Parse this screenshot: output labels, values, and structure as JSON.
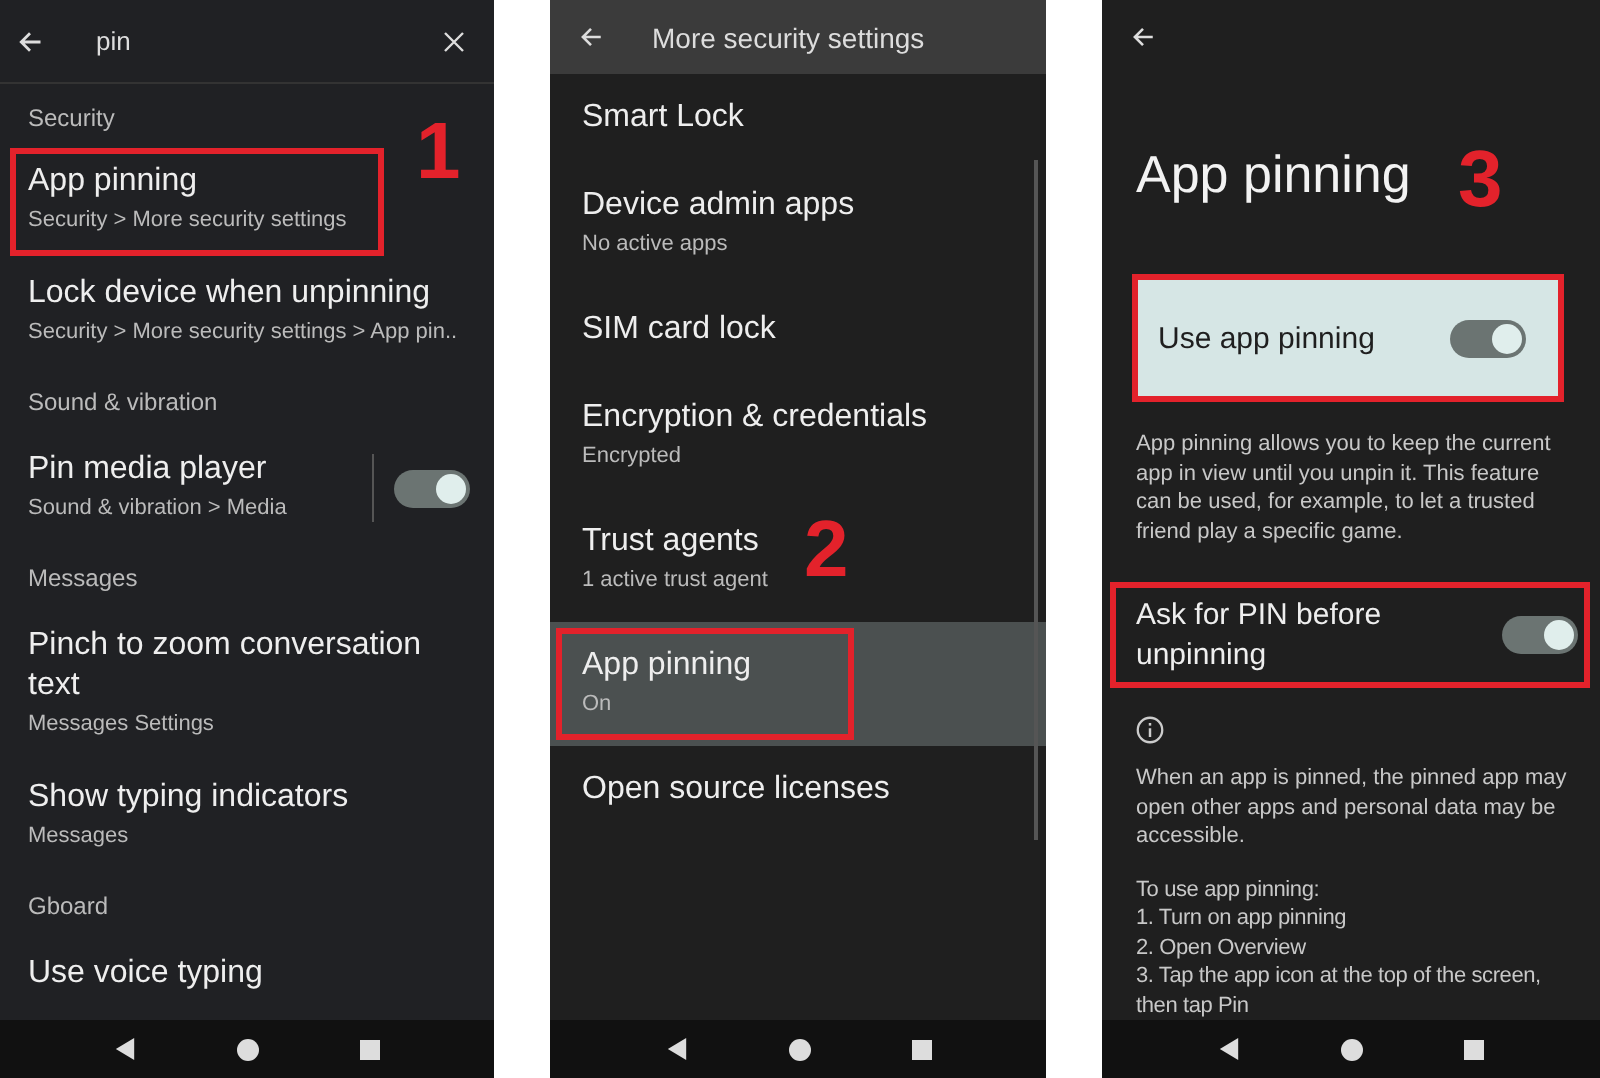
{
  "search_screen": {
    "query": "pin",
    "step_label": "1",
    "sections": [
      {
        "heading": "Security",
        "items": [
          {
            "title": "App pinning",
            "subtitle": "Security > More security settings",
            "highlighted": true
          },
          {
            "title": "Lock device when unpinning",
            "subtitle": "Security > More security settings > App pin..",
            "highlighted": false
          }
        ]
      },
      {
        "heading": "Sound & vibration",
        "items": [
          {
            "title": "Pin media player",
            "subtitle": "Sound & vibration > Media",
            "highlighted": false,
            "toggle": {
              "on": true
            }
          }
        ]
      },
      {
        "heading": "Messages",
        "items": [
          {
            "title": "Pinch to zoom conversation text",
            "subtitle": "Messages Settings",
            "highlighted": false
          },
          {
            "title": "Show typing indicators",
            "subtitle": "Messages",
            "highlighted": false
          }
        ]
      },
      {
        "heading": "Gboard",
        "items": [
          {
            "title": "Use voice typing",
            "highlighted": false
          }
        ]
      }
    ]
  },
  "security_screen": {
    "title": "More security settings",
    "step_label": "2",
    "items": [
      {
        "title": "Smart Lock",
        "selected": false,
        "highlighted": false
      },
      {
        "title": "Device admin apps",
        "subtitle": "No active apps",
        "selected": false,
        "highlighted": false
      },
      {
        "title": "SIM card lock",
        "selected": false,
        "highlighted": false
      },
      {
        "title": "Encryption & credentials",
        "subtitle": "Encrypted",
        "selected": false,
        "highlighted": false
      },
      {
        "title": "Trust agents",
        "subtitle": "1 active trust agent",
        "selected": false,
        "highlighted": false
      },
      {
        "title": "App pinning",
        "subtitle": "On",
        "selected": true,
        "highlighted": true
      },
      {
        "title": "Open source licenses",
        "selected": false,
        "highlighted": false
      }
    ]
  },
  "pinning_screen": {
    "title": "App pinning",
    "step_label": "3",
    "settings": [
      {
        "kind": "main",
        "label": "Use app pinning",
        "on": true,
        "highlighted": true,
        "description": "App pinning allows you to keep the current app in view until you unpin it. This feature can be used, for example, to let a trusted friend play a specific game."
      },
      {
        "kind": "row",
        "label": "Ask for PIN before unpinning",
        "on": true,
        "highlighted": true
      }
    ],
    "notice": "When an app is pinned, the pinned app may open other apps and personal data may be accessible.",
    "instructions_heading": "To use app pinning:",
    "steps": [
      "1. Turn on app pinning",
      "2. Open Overview",
      "3. Tap the app icon at the top of the screen, then tap Pin"
    ]
  }
}
